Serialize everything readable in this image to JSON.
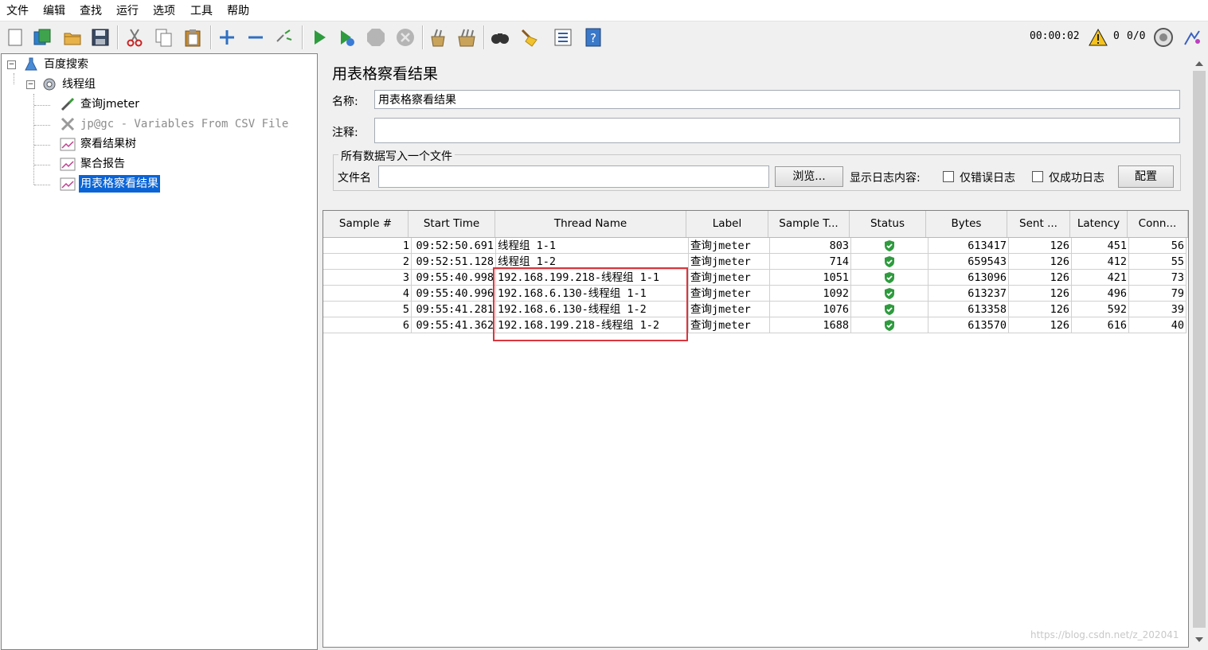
{
  "menu": [
    "文件",
    "编辑",
    "查找",
    "运行",
    "选项",
    "工具",
    "帮助"
  ],
  "toolbar": {
    "buttons": [
      "new-icon",
      "templates-icon",
      "open-icon",
      "save-icon",
      "cut-icon",
      "copy-icon",
      "paste-icon",
      "expand-icon",
      "collapse-icon",
      "toggle-icon",
      "start-icon",
      "start-no-pause-icon",
      "stop-icon",
      "shutdown-icon",
      "clear-icon",
      "clear-all-icon",
      "search-icon",
      "reset-search-icon",
      "function-helper-icon",
      "help-icon"
    ],
    "elapsed_time": "00:00:02",
    "warning_count": "0",
    "thread_count": "0/0"
  },
  "tree": {
    "items": [
      {
        "label": "百度搜索",
        "icon": "test-plan-icon",
        "level": 0
      },
      {
        "label": "线程组",
        "icon": "thread-group-icon",
        "level": 1
      },
      {
        "label": "查询jmeter",
        "icon": "sampler-icon",
        "level": 2
      },
      {
        "label": "jp@gc - Variables From CSV File",
        "icon": "config-icon",
        "level": 2,
        "disabled": true
      },
      {
        "label": "察看结果树",
        "icon": "listener-icon",
        "level": 2
      },
      {
        "label": "聚合报告",
        "icon": "listener-icon",
        "level": 2
      },
      {
        "label": "用表格察看结果",
        "icon": "listener-icon",
        "level": 2,
        "selected": true
      }
    ]
  },
  "panel": {
    "title": "用表格察看结果",
    "name_label": "名称:",
    "name_value": "用表格察看结果",
    "comment_label": "注释:",
    "comment_value": "",
    "file_group_title": "所有数据写入一个文件",
    "filename_label": "文件名",
    "filename_value": "",
    "browse_label": "浏览...",
    "log_display_label": "显示日志内容:",
    "errors_only_label": "仅错误日志",
    "success_only_label": "仅成功日志",
    "configure_label": "配置"
  },
  "table": {
    "columns": [
      "Sample #",
      "Start Time",
      "Thread Name",
      "Label",
      "Sample T...",
      "Status",
      "Bytes",
      "Sent ...",
      "Latency",
      "Conn..."
    ],
    "rows": [
      {
        "sample": "1",
        "start": "09:52:50.691",
        "thread": "线程组 1-1",
        "label": "查询jmeter",
        "time": "803",
        "status": "success",
        "bytes": "613417",
        "sent": "126",
        "latency": "451",
        "conn": "56"
      },
      {
        "sample": "2",
        "start": "09:52:51.128",
        "thread": "线程组 1-2",
        "label": "查询jmeter",
        "time": "714",
        "status": "success",
        "bytes": "659543",
        "sent": "126",
        "latency": "412",
        "conn": "55"
      },
      {
        "sample": "3",
        "start": "09:55:40.998",
        "thread": "192.168.199.218-线程组 1-1",
        "label": "查询jmeter",
        "time": "1051",
        "status": "success",
        "bytes": "613096",
        "sent": "126",
        "latency": "421",
        "conn": "73"
      },
      {
        "sample": "4",
        "start": "09:55:40.996",
        "thread": "192.168.6.130-线程组 1-1",
        "label": "查询jmeter",
        "time": "1092",
        "status": "success",
        "bytes": "613237",
        "sent": "126",
        "latency": "496",
        "conn": "79"
      },
      {
        "sample": "5",
        "start": "09:55:41.281",
        "thread": "192.168.6.130-线程组 1-2",
        "label": "查询jmeter",
        "time": "1076",
        "status": "success",
        "bytes": "613358",
        "sent": "126",
        "latency": "592",
        "conn": "39"
      },
      {
        "sample": "6",
        "start": "09:55:41.362",
        "thread": "192.168.199.218-线程组 1-2",
        "label": "查询jmeter",
        "time": "1688",
        "status": "success",
        "bytes": "613570",
        "sent": "126",
        "latency": "616",
        "conn": "40"
      }
    ]
  },
  "watermark": "https://blog.csdn.net/z_202041",
  "colors": {
    "selection": "#0a64d6",
    "highlight_box": "#d9363e",
    "status_ok": "#2e9b3e"
  }
}
